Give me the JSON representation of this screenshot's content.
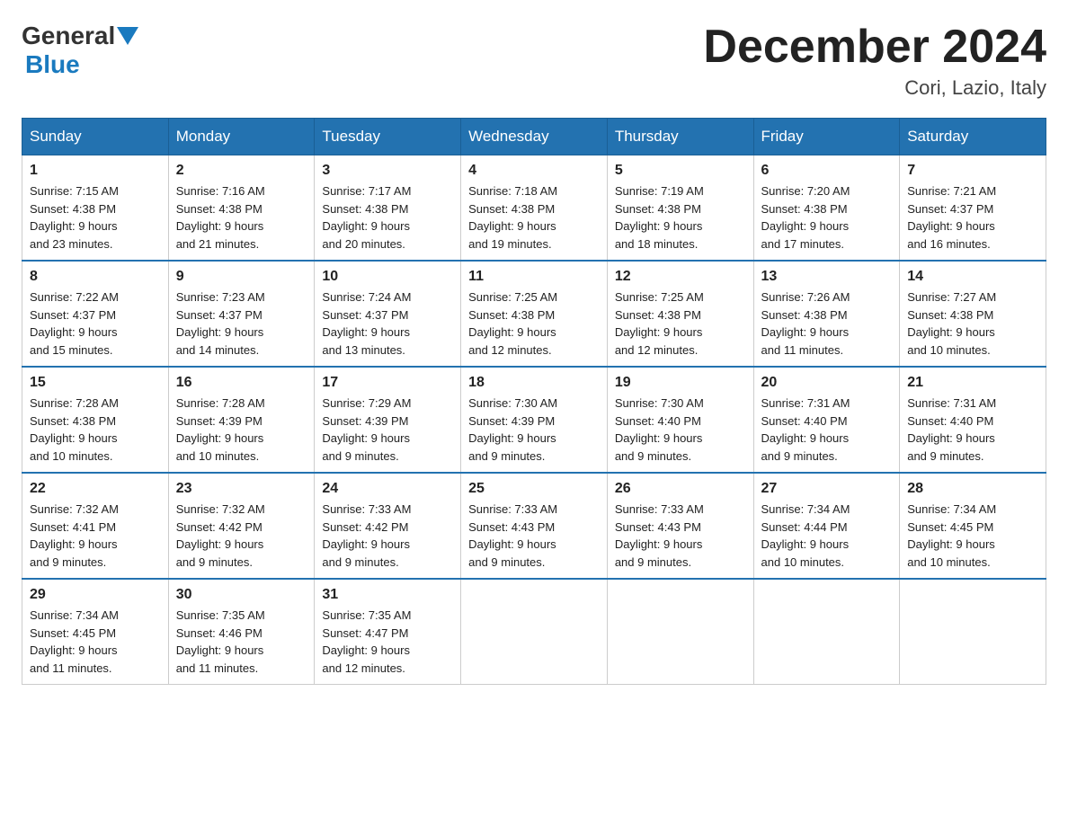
{
  "header": {
    "logo_general": "General",
    "logo_blue": "Blue",
    "month_title": "December 2024",
    "location": "Cori, Lazio, Italy"
  },
  "weekdays": [
    "Sunday",
    "Monday",
    "Tuesday",
    "Wednesday",
    "Thursday",
    "Friday",
    "Saturday"
  ],
  "weeks": [
    [
      {
        "day": "1",
        "sunrise": "7:15 AM",
        "sunset": "4:38 PM",
        "daylight": "9 hours and 23 minutes."
      },
      {
        "day": "2",
        "sunrise": "7:16 AM",
        "sunset": "4:38 PM",
        "daylight": "9 hours and 21 minutes."
      },
      {
        "day": "3",
        "sunrise": "7:17 AM",
        "sunset": "4:38 PM",
        "daylight": "9 hours and 20 minutes."
      },
      {
        "day": "4",
        "sunrise": "7:18 AM",
        "sunset": "4:38 PM",
        "daylight": "9 hours and 19 minutes."
      },
      {
        "day": "5",
        "sunrise": "7:19 AM",
        "sunset": "4:38 PM",
        "daylight": "9 hours and 18 minutes."
      },
      {
        "day": "6",
        "sunrise": "7:20 AM",
        "sunset": "4:38 PM",
        "daylight": "9 hours and 17 minutes."
      },
      {
        "day": "7",
        "sunrise": "7:21 AM",
        "sunset": "4:37 PM",
        "daylight": "9 hours and 16 minutes."
      }
    ],
    [
      {
        "day": "8",
        "sunrise": "7:22 AM",
        "sunset": "4:37 PM",
        "daylight": "9 hours and 15 minutes."
      },
      {
        "day": "9",
        "sunrise": "7:23 AM",
        "sunset": "4:37 PM",
        "daylight": "9 hours and 14 minutes."
      },
      {
        "day": "10",
        "sunrise": "7:24 AM",
        "sunset": "4:37 PM",
        "daylight": "9 hours and 13 minutes."
      },
      {
        "day": "11",
        "sunrise": "7:25 AM",
        "sunset": "4:38 PM",
        "daylight": "9 hours and 12 minutes."
      },
      {
        "day": "12",
        "sunrise": "7:25 AM",
        "sunset": "4:38 PM",
        "daylight": "9 hours and 12 minutes."
      },
      {
        "day": "13",
        "sunrise": "7:26 AM",
        "sunset": "4:38 PM",
        "daylight": "9 hours and 11 minutes."
      },
      {
        "day": "14",
        "sunrise": "7:27 AM",
        "sunset": "4:38 PM",
        "daylight": "9 hours and 10 minutes."
      }
    ],
    [
      {
        "day": "15",
        "sunrise": "7:28 AM",
        "sunset": "4:38 PM",
        "daylight": "9 hours and 10 minutes."
      },
      {
        "day": "16",
        "sunrise": "7:28 AM",
        "sunset": "4:39 PM",
        "daylight": "9 hours and 10 minutes."
      },
      {
        "day": "17",
        "sunrise": "7:29 AM",
        "sunset": "4:39 PM",
        "daylight": "9 hours and 9 minutes."
      },
      {
        "day": "18",
        "sunrise": "7:30 AM",
        "sunset": "4:39 PM",
        "daylight": "9 hours and 9 minutes."
      },
      {
        "day": "19",
        "sunrise": "7:30 AM",
        "sunset": "4:40 PM",
        "daylight": "9 hours and 9 minutes."
      },
      {
        "day": "20",
        "sunrise": "7:31 AM",
        "sunset": "4:40 PM",
        "daylight": "9 hours and 9 minutes."
      },
      {
        "day": "21",
        "sunrise": "7:31 AM",
        "sunset": "4:40 PM",
        "daylight": "9 hours and 9 minutes."
      }
    ],
    [
      {
        "day": "22",
        "sunrise": "7:32 AM",
        "sunset": "4:41 PM",
        "daylight": "9 hours and 9 minutes."
      },
      {
        "day": "23",
        "sunrise": "7:32 AM",
        "sunset": "4:42 PM",
        "daylight": "9 hours and 9 minutes."
      },
      {
        "day": "24",
        "sunrise": "7:33 AM",
        "sunset": "4:42 PM",
        "daylight": "9 hours and 9 minutes."
      },
      {
        "day": "25",
        "sunrise": "7:33 AM",
        "sunset": "4:43 PM",
        "daylight": "9 hours and 9 minutes."
      },
      {
        "day": "26",
        "sunrise": "7:33 AM",
        "sunset": "4:43 PM",
        "daylight": "9 hours and 9 minutes."
      },
      {
        "day": "27",
        "sunrise": "7:34 AM",
        "sunset": "4:44 PM",
        "daylight": "9 hours and 10 minutes."
      },
      {
        "day": "28",
        "sunrise": "7:34 AM",
        "sunset": "4:45 PM",
        "daylight": "9 hours and 10 minutes."
      }
    ],
    [
      {
        "day": "29",
        "sunrise": "7:34 AM",
        "sunset": "4:45 PM",
        "daylight": "9 hours and 11 minutes."
      },
      {
        "day": "30",
        "sunrise": "7:35 AM",
        "sunset": "4:46 PM",
        "daylight": "9 hours and 11 minutes."
      },
      {
        "day": "31",
        "sunrise": "7:35 AM",
        "sunset": "4:47 PM",
        "daylight": "9 hours and 12 minutes."
      },
      null,
      null,
      null,
      null
    ]
  ],
  "labels": {
    "sunrise": "Sunrise:",
    "sunset": "Sunset:",
    "daylight": "Daylight:"
  }
}
